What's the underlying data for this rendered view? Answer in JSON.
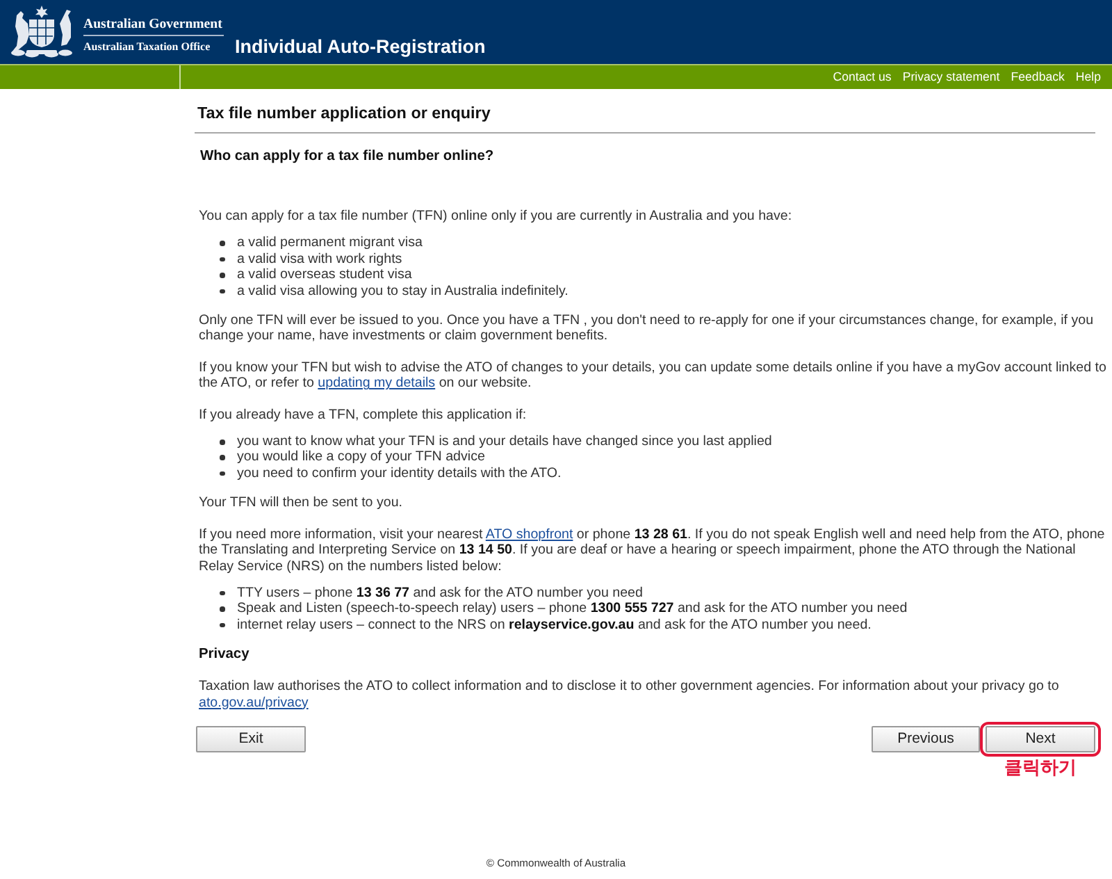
{
  "header": {
    "agency": [
      "Australian Government",
      "Australian Taxation Office"
    ],
    "title": "Individual Auto-Registration"
  },
  "utility_links": [
    "Contact us",
    "Privacy statement",
    "Feedback",
    "Help"
  ],
  "page_title": "Tax file number application or enquiry",
  "section_title": "Who can apply for a tax file number online?",
  "content": [
    {
      "kind": "paragraph",
      "parts": [
        {
          "kind": "text",
          "text": "You can apply for a tax file number (TFN) online only if you are currently in Australia and you have:"
        }
      ]
    },
    {
      "kind": "list",
      "items": [
        "a valid permanent migrant visa",
        "a valid visa with work rights",
        "a valid overseas student visa",
        "a valid visa allowing you to stay in Australia indefinitely."
      ]
    },
    {
      "kind": "paragraph",
      "parts": [
        {
          "kind": "text",
          "text": "Only one TFN will ever be issued to you. Once you have a TFN , you don't need to re-apply for one if your circumstances change, for example, if you change your name, have investments or claim government benefits."
        }
      ]
    },
    {
      "kind": "paragraph",
      "parts": [
        {
          "kind": "text",
          "text": "If you know your TFN but wish to advise the ATO of changes to your details, you can update some details online if you have a myGov account linked to the ATO, or refer to "
        },
        {
          "kind": "link",
          "text": "updating my details"
        },
        {
          "kind": "text",
          "text": " on our website."
        }
      ]
    },
    {
      "kind": "paragraph",
      "parts": [
        {
          "kind": "text",
          "text": "If you already have a TFN, complete this application if:"
        }
      ]
    },
    {
      "kind": "list",
      "items": [
        "you want to know what your TFN is and your details have changed since you last applied",
        "you would like a copy of your TFN advice",
        "you need to confirm your identity details with the ATO."
      ]
    },
    {
      "kind": "paragraph",
      "parts": [
        {
          "kind": "text",
          "text": "Your TFN will then be sent to you."
        }
      ]
    },
    {
      "kind": "paragraph",
      "parts": [
        {
          "kind": "text",
          "text": "If you need more information, visit your nearest "
        },
        {
          "kind": "link",
          "text": "ATO shopfront"
        },
        {
          "kind": "text",
          "text": " or phone **13 28 61**. If you do not speak English well and need help from the ATO, phone the Translating and Interpreting Service on **13 14 50**. If you are deaf or have a hearing or speech impairment, phone the ATO through the National Relay Service (NRS) on the numbers listed below:"
        }
      ]
    },
    {
      "kind": "list",
      "items": [
        "TTY users – phone **13 36 77** and ask for the ATO number you need",
        "Speak and Listen (speech-to-speech relay) users – phone **1300 555 727** and ask for the ATO number you need",
        "internet relay users – connect to the NRS on **relayservice.gov.au** and ask for the ATO number you need."
      ]
    },
    {
      "kind": "heading",
      "text": "Privacy"
    },
    {
      "kind": "paragraph",
      "parts": [
        {
          "kind": "text",
          "text": "Taxation law authorises the ATO to collect information and to disclose it to other government agencies. For information about your privacy go to "
        },
        {
          "kind": "link",
          "text": "ato.gov.au/privacy"
        }
      ]
    }
  ],
  "buttons": {
    "left": [
      {
        "label": "Exit",
        "highlighted": false
      }
    ],
    "right": [
      {
        "label": "Previous",
        "highlighted": false
      },
      {
        "label": "Next",
        "highlighted": true
      }
    ]
  },
  "annotation": {
    "text": "클릭하기"
  },
  "footer": "© Commonwealth of Australia"
}
